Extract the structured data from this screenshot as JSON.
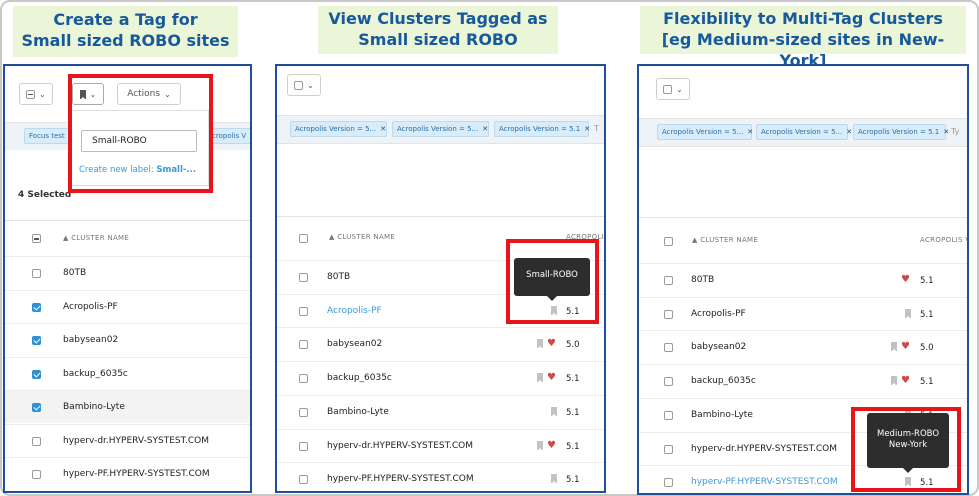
{
  "captions": {
    "left": [
      "Create a Tag for",
      "Small sized ROBO sites"
    ],
    "middle": [
      "View Clusters Tagged as",
      "Small sized ROBO"
    ],
    "right": [
      "Flexibility to Multi-Tag Clusters",
      "[eg Medium-sized sites in New-York]"
    ]
  },
  "left_panel": {
    "actions_label": "Actions",
    "chip_partial_left": "Focus test",
    "chip_partial_right": "cropolis V",
    "tag_input_value": "Small-ROBO",
    "create_label_text": "Create new label: ",
    "create_label_value": "Small-...",
    "selected_count": "4 Selected",
    "column_header": "CLUSTER NAME",
    "rows": [
      {
        "name": "80TB",
        "checked": false
      },
      {
        "name": "Acropolis-PF",
        "checked": true
      },
      {
        "name": "babysean02",
        "checked": true
      },
      {
        "name": "backup_6035c",
        "checked": true
      },
      {
        "name": "Bambino-Lyte",
        "checked": true
      },
      {
        "name": "hyperv-dr.HYPERV-SYSTEST.COM",
        "checked": false
      },
      {
        "name": "hyperv-PF.HYPERV-SYSTEST.COM",
        "checked": false
      }
    ]
  },
  "middle_panel": {
    "chips": [
      "Acropolis Version = 5...",
      "Acropolis Version = 5...",
      "Acropolis Version = 5.1",
      "T"
    ],
    "column_header": "CLUSTER NAME",
    "version_header": "ACROPOLI",
    "tooltip": "Small-ROBO",
    "rows": [
      {
        "name": "80TB",
        "tag": false,
        "heart": false,
        "version": ""
      },
      {
        "name": "Acropolis-PF",
        "tag": true,
        "heart": false,
        "version": "5.1",
        "link": true
      },
      {
        "name": "babysean02",
        "tag": true,
        "heart": true,
        "version": "5.0"
      },
      {
        "name": "backup_6035c",
        "tag": true,
        "heart": true,
        "version": "5.1"
      },
      {
        "name": "Bambino-Lyte",
        "tag": true,
        "heart": false,
        "version": "5.1"
      },
      {
        "name": "hyperv-dr.HYPERV-SYSTEST.COM",
        "tag": true,
        "heart": true,
        "version": "5.1"
      },
      {
        "name": "hyperv-PF.HYPERV-SYSTEST.COM",
        "tag": true,
        "heart": false,
        "version": "5.1"
      }
    ]
  },
  "right_panel": {
    "chips": [
      "Acropolis Version = 5...",
      "Acropolis Version = 5...",
      "Acropolis Version = 5.1",
      "Ty"
    ],
    "column_header": "CLUSTER NAME",
    "version_header": "ACROPOLIS V",
    "tooltip_line1": "Medium-ROBO",
    "tooltip_line2": "New-York",
    "rows": [
      {
        "name": "80TB",
        "tag": false,
        "heart": true,
        "version": "5.1"
      },
      {
        "name": "Acropolis-PF",
        "tag": true,
        "heart": false,
        "version": "5.1"
      },
      {
        "name": "babysean02",
        "tag": true,
        "heart": true,
        "version": "5.0"
      },
      {
        "name": "backup_6035c",
        "tag": true,
        "heart": true,
        "version": "5.1"
      },
      {
        "name": "Bambino-Lyte",
        "tag": true,
        "heart": false,
        "version": "5.1"
      },
      {
        "name": "hyperv-dr.HYPERV-SYSTEST.COM",
        "tag": false,
        "heart": false,
        "version": "5.1"
      },
      {
        "name": "hyperv-PF.HYPERV-SYSTEST.COM",
        "tag": true,
        "heart": false,
        "version": "5.1",
        "link": true
      }
    ]
  },
  "colors": {
    "caption_bg": "#ebf5d8",
    "caption_text": "#17599b",
    "panel_border": "#1f4e9a",
    "highlight": "#e8141a",
    "link": "#3b9ad8"
  }
}
